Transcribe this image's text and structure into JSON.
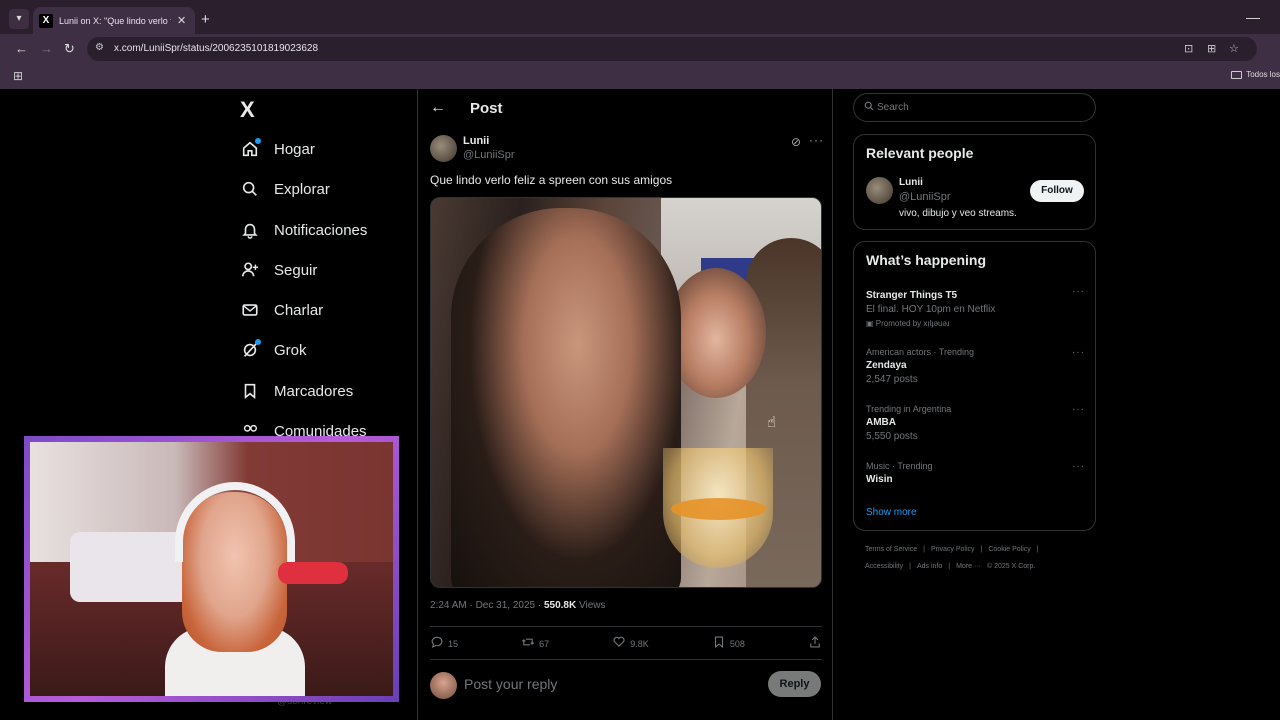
{
  "browser": {
    "tab_title": "Lunii on X: \"Que lindo verlo feliz",
    "tab_icon": "X",
    "url": "x.com/LuniiSpr/status/2006235101819023628",
    "bookmarks_label": "Todos los"
  },
  "sidebar": {
    "logo": "X",
    "items": [
      {
        "label": "Hogar",
        "icon": "home-icon"
      },
      {
        "label": "Explorar",
        "icon": "search-icon"
      },
      {
        "label": "Notificaciones",
        "icon": "bell-icon"
      },
      {
        "label": "Seguir",
        "icon": "add-person-icon"
      },
      {
        "label": "Charlar",
        "icon": "mail-icon"
      },
      {
        "label": "Grok",
        "icon": "grok-icon"
      },
      {
        "label": "Marcadores",
        "icon": "bookmark-icon"
      },
      {
        "label": "Comunidades",
        "icon": "people-icon"
      }
    ],
    "partial_handle": "@sonreview"
  },
  "post": {
    "header": "Post",
    "author": {
      "name": "Lunii",
      "handle": "@LuniiSpr"
    },
    "text": "Que lindo verlo feliz a spreen con sus amigos",
    "timestamp": "2:24 AM · Dec 31, 2025 · ",
    "views_count": "550.8K",
    "views_label": " Views",
    "actions": {
      "replies": "15",
      "reposts": "67",
      "likes": "9.8K",
      "bookmarks": "508"
    },
    "reply_placeholder": "Post your reply",
    "reply_button": "Reply"
  },
  "right": {
    "search_placeholder": "Search",
    "relevant_people": {
      "title": "Relevant people",
      "name": "Lunii",
      "handle": "@LuniiSpr",
      "bio": "vivo, dibujo y veo streams.",
      "follow_label": "Follow"
    },
    "whats_happening": {
      "title": "What’s happening",
      "trends": [
        {
          "context": "",
          "title": "Stranger Things T5",
          "sub": "El final. HOY 10pm en Netflix",
          "promo": "Promoted by xı̣lɟǝuǝɹ"
        },
        {
          "context": "American actors · Trending",
          "title": "Zendaya",
          "sub": "2,547 posts",
          "promo": ""
        },
        {
          "context": "Trending in Argentina",
          "title": "AMBA",
          "sub": "5,550 posts",
          "promo": ""
        },
        {
          "context": "Music · Trending",
          "title": "Wisin",
          "sub": "",
          "promo": ""
        }
      ],
      "show_more": "Show more"
    },
    "footer_row1": [
      "Terms of Service",
      "|",
      "Privacy Policy",
      "|",
      "Cookie Policy",
      "|"
    ],
    "footer_row2": [
      "Accessibility",
      "|",
      "Ads info",
      "|",
      "More ···",
      "© 2025 X Corp."
    ]
  },
  "colors": {
    "accent": "#1d9bf0",
    "background": "#000000",
    "chrome": "#3e2f44",
    "webcam_border": "#b85cd8"
  }
}
